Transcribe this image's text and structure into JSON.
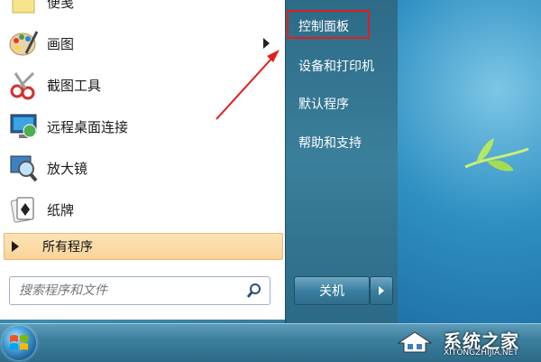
{
  "programs": [
    {
      "label": "便笺",
      "icon": "sticky-note-icon"
    },
    {
      "label": "画图",
      "icon": "paint-palette-icon",
      "has_submenu": true
    },
    {
      "label": "截图工具",
      "icon": "scissors-icon"
    },
    {
      "label": "远程桌面连接",
      "icon": "remote-desktop-icon"
    },
    {
      "label": "放大镜",
      "icon": "magnifier-icon"
    },
    {
      "label": "纸牌",
      "icon": "playing-card-icon"
    }
  ],
  "all_programs": {
    "label": "所有程序"
  },
  "search": {
    "placeholder": "搜索程序和文件"
  },
  "right_pane": {
    "items": [
      {
        "label": "控制面板",
        "highlighted": true
      },
      {
        "label": "设备和打印机"
      },
      {
        "label": "默认程序"
      },
      {
        "label": "帮助和支持"
      }
    ]
  },
  "shutdown": {
    "label": "关机"
  },
  "watermark": {
    "title": "系统之家",
    "subtitle": "XITONGZHIJIA.NET"
  },
  "colors": {
    "highlight_border": "#e01e1e",
    "arrow": "#e01e1e",
    "all_programs_bg": "#fbd49a"
  }
}
